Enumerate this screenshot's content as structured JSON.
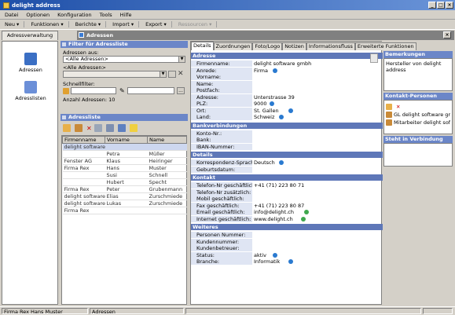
{
  "window": {
    "title": "delight address"
  },
  "menu": [
    "Datei",
    "Optionen",
    "Konfiguration",
    "Tools",
    "Hilfe"
  ],
  "toolbar": [
    "Neu",
    "Funktionen",
    "Berichte",
    "Import",
    "Export",
    "Ressourcen"
  ],
  "nav": {
    "tab_label": "Adressverwaltung",
    "items": [
      {
        "label": "Adressen"
      },
      {
        "label": "Adresslisten"
      }
    ]
  },
  "doc_tab": {
    "label": "Adressen"
  },
  "filter": {
    "header": "Filter für Adressliste",
    "source_label": "Adressen aus:",
    "source_value": "<Alle Adressen>",
    "list_label": "<Alle Adressen>",
    "quick_label": "Schnellfilter:",
    "count_label": "Anzahl Adressen: 10"
  },
  "address_list": {
    "header": "Adressliste",
    "columns": [
      "Firmenname",
      "Vorname",
      "Name"
    ],
    "rows": [
      [
        "delight software gmbh",
        "",
        ""
      ],
      [
        "",
        "Petra",
        "Müller"
      ],
      [
        "Fenster AG",
        "Klaus",
        "Heiringer"
      ],
      [
        "Firma Rex",
        "Hans",
        "Muster"
      ],
      [
        "",
        "Susi",
        "Schnell"
      ],
      [
        "",
        "Hubert",
        "Specht"
      ],
      [
        "Firma Rex",
        "Peter",
        "Grubenmann"
      ],
      [
        "delight software gmbh",
        "Elias",
        "Zurschmiede"
      ],
      [
        "delight software gmbh",
        "Lukas",
        "Zurschmiede"
      ],
      [
        "Firma Rex",
        "",
        ""
      ]
    ]
  },
  "detail": {
    "tabs": [
      "Details",
      "Zuordnungen",
      "Foto/Logo",
      "Notizen",
      "Informationsfluss",
      "Erweiterte Funktionen"
    ],
    "sections": {
      "adresse": "Adresse",
      "bank": "Bankverbindungen",
      "details": "Details",
      "kontakt": "Kontakt",
      "weiteres": "Weiteres"
    },
    "adresse": [
      {
        "label": "Firmenname:",
        "value": "delight software gmbh"
      },
      {
        "label": "Anrede:",
        "value": "Firma"
      },
      {
        "label": "Vorname:",
        "value": ""
      },
      {
        "label": "Name:",
        "value": ""
      },
      {
        "label": "Postfach:",
        "value": ""
      },
      {
        "label": "Adresse:",
        "value": "Unterstrasse 39"
      },
      {
        "label": "PLZ:",
        "value": "9000"
      },
      {
        "label": "Ort:",
        "value": "St. Gallen"
      },
      {
        "label": "Land:",
        "value": "Schweiz"
      }
    ],
    "bank": [
      {
        "label": "Konto-Nr.:",
        "value": ""
      },
      {
        "label": "Bank:",
        "value": ""
      },
      {
        "label": "IBAN-Nummer:",
        "value": ""
      }
    ],
    "details": [
      {
        "label": "Korrespondenz-Sprache:",
        "value": "Deutsch"
      },
      {
        "label": "Geburtsdatum:",
        "value": ""
      }
    ],
    "kontakt": [
      {
        "label": "Telefon-Nr geschäftlich:",
        "value": "+41 (71) 223 80 71"
      },
      {
        "label": "Telefon-Nr zusätzlich:",
        "value": ""
      },
      {
        "label": "Mobil geschäftlich:",
        "value": ""
      },
      {
        "label": "Fax geschäftlich:",
        "value": "+41 (71) 223 80 87"
      },
      {
        "label": "Email geschäftlich:",
        "value": "info@delight.ch"
      },
      {
        "label": "Internet geschäftlich:",
        "value": "www.delight.ch"
      }
    ],
    "weiteres": [
      {
        "label": "Personen Nummer:",
        "value": ""
      },
      {
        "label": "Kundennummer:",
        "value": ""
      },
      {
        "label": "Kundenbetreuer:",
        "value": ""
      },
      {
        "label": "Status:",
        "value": "aktiv"
      },
      {
        "label": "Branche:",
        "value": "Informatik"
      }
    ]
  },
  "right": {
    "bemerkungen": {
      "header": "Bemerkungen",
      "text": "Hersteller von delight address"
    },
    "kontakt": {
      "header": "Kontakt-Personen",
      "items": [
        "GL delight software gmb",
        "Mitarbeiter delight softwa"
      ]
    },
    "verbindung": {
      "header": "Steht in Verbindung m..."
    }
  },
  "status": {
    "left": "Firma Rex Hans Muster",
    "middle": "Adressen"
  }
}
